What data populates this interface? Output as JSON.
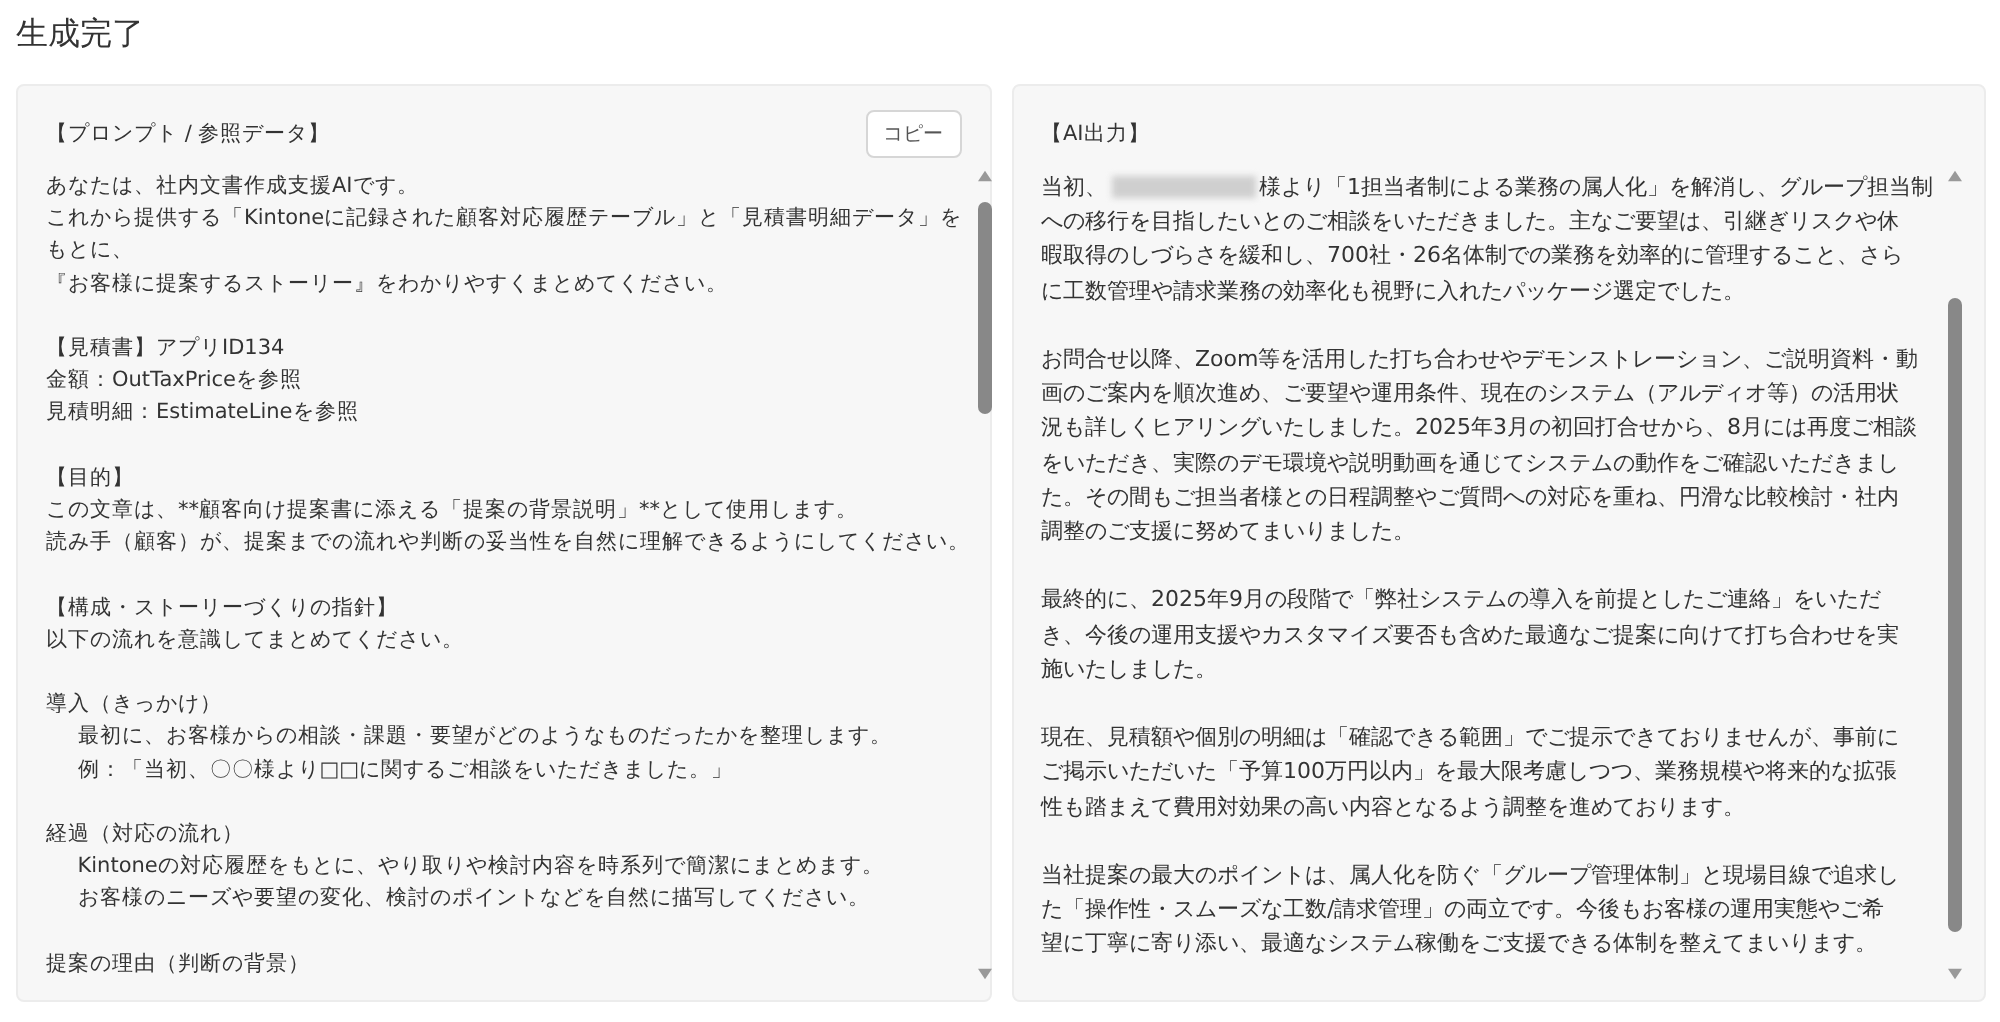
{
  "title": "生成完了",
  "prompt_panel": {
    "heading": "【プロンプト / 参照データ】",
    "copy_button": "コピー",
    "paragraphs": [
      [
        {
          "text": "あなたは、社内文書作成支援AIです。",
          "indent": false
        },
        {
          "text": "これから提供する「Kintoneに記録された顧客対応履歴テーブル」と「見積書明細データ」を",
          "indent": false
        },
        {
          "text": "もとに、",
          "indent": false
        },
        {
          "text": "『お客様に提案するストーリー』をわかりやすくまとめてください。",
          "indent": false
        }
      ],
      [
        {
          "text": "【見積書】アプリID134",
          "indent": false
        },
        {
          "text": "金額：OutTaxPriceを参照",
          "indent": false
        },
        {
          "text": "見積明細：EstimateLineを参照",
          "indent": false
        }
      ],
      [
        {
          "text": "【目的】",
          "indent": false
        },
        {
          "text": "この文章は、**顧客向け提案書に添える「提案の背景説明」**として使用します。",
          "indent": false
        },
        {
          "text": "読み手（顧客）が、提案までの流れや判断の妥当性を自然に理解できるようにしてください。",
          "indent": false
        }
      ],
      [
        {
          "text": "【構成・ストーリーづくりの指針】",
          "indent": false
        },
        {
          "text": "以下の流れを意識してまとめてください。",
          "indent": false
        }
      ],
      [
        {
          "text": "導入（きっかけ）",
          "indent": false
        },
        {
          "text": "最初に、お客様からの相談・課題・要望がどのようなものだったかを整理します。",
          "indent": true
        },
        {
          "text": "例：「当初、〇〇様より□□に関するご相談をいただきました。」",
          "indent": true
        }
      ],
      [
        {
          "text": "経過（対応の流れ）",
          "indent": false
        },
        {
          "text": "Kintoneの対応履歴をもとに、やり取りや検討内容を時系列で簡潔にまとめます。",
          "indent": true
        },
        {
          "text": "お客様のニーズや要望の変化、検討のポイントなどを自然に描写してください。",
          "indent": true
        }
      ],
      [
        {
          "text": "提案の理由（判断の背景）",
          "indent": false
        }
      ]
    ]
  },
  "output_panel": {
    "heading": "【AI出力】",
    "paragraphs": [
      [
        {
          "kind": "redacted",
          "before": "当初、",
          "after": "様より「1担当者制による業務の属人化」を解消し、グループ担当制"
        },
        {
          "kind": "plain",
          "text": "への移行を目指したいとのご相談をいただきました。主なご要望は、引継ぎリスクや休"
        },
        {
          "kind": "plain",
          "text": "暇取得のしづらさを緩和し、700社・26名体制での業務を効率的に管理すること、さら"
        },
        {
          "kind": "plain",
          "text": "に工数管理や請求業務の効率化も視野に入れたパッケージ選定でした。"
        }
      ],
      [
        {
          "kind": "plain",
          "text": "お問合せ以降、Zoom等を活用した打ち合わせやデモンストレーション、ご説明資料・動"
        },
        {
          "kind": "plain",
          "text": "画のご案内を順次進め、ご要望や運用条件、現在のシステム（アルディオ等）の活用状"
        },
        {
          "kind": "plain",
          "text": "況も詳しくヒアリングいたしました。2025年3月の初回打合せから、8月には再度ご相談"
        },
        {
          "kind": "plain",
          "text": "をいただき、実際のデモ環境や説明動画を通じてシステムの動作をご確認いただきまし"
        },
        {
          "kind": "plain",
          "text": "た。その間もご担当者様との日程調整やご質問への対応を重ね、円滑な比較検討・社内"
        },
        {
          "kind": "plain",
          "text": "調整のご支援に努めてまいりました。"
        }
      ],
      [
        {
          "kind": "plain",
          "text": "最終的に、2025年9月の段階で「弊社システムの導入を前提としたご連絡」をいただ"
        },
        {
          "kind": "plain",
          "text": "き、今後の運用支援やカスタマイズ要否も含めた最適なご提案に向けて打ち合わせを実"
        },
        {
          "kind": "plain",
          "text": "施いたしました。"
        }
      ],
      [
        {
          "kind": "plain",
          "text": "現在、見積額や個別の明細は「確認できる範囲」でご提示できておりませんが、事前に"
        },
        {
          "kind": "plain",
          "text": "ご掲示いただいた「予算100万円以内」を最大限考慮しつつ、業務規模や将来的な拡張"
        },
        {
          "kind": "plain",
          "text": "性も踏まえて費用対効果の高い内容となるよう調整を進めております。"
        }
      ],
      [
        {
          "kind": "plain",
          "text": "当社提案の最大のポイントは、属人化を防ぐ「グループ管理体制」と現場目線で追求し"
        },
        {
          "kind": "plain",
          "text": "た「操作性・スムーズな工数/請求管理」の両立です。今後もお客様の運用実態やご希"
        },
        {
          "kind": "plain",
          "text": "望に丁寧に寄り添い、最適なシステム稼働をご支援できる体制を整えてまいります。"
        }
      ]
    ]
  }
}
